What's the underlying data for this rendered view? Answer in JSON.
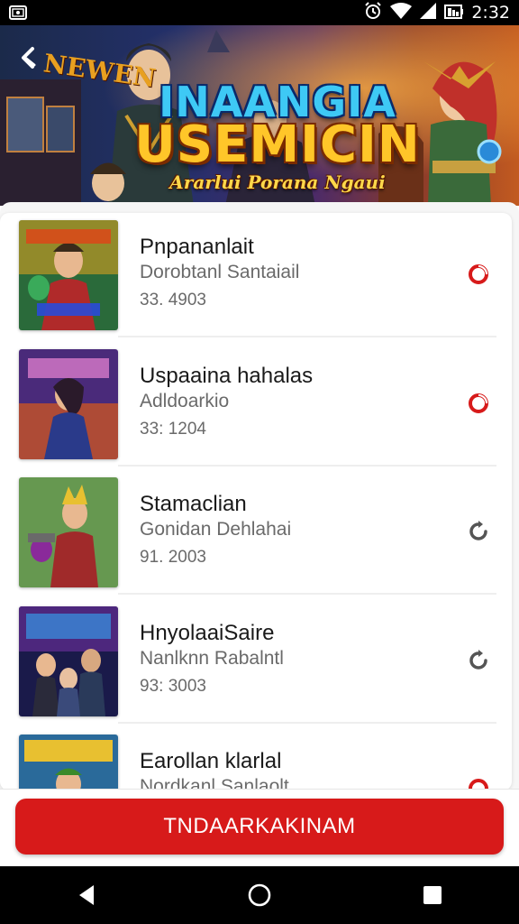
{
  "status_bar": {
    "time": "2:32",
    "app_badge": "Ⓚ",
    "icons": [
      "alarm-icon",
      "wifi-icon",
      "signal-icon",
      "battery-icon"
    ]
  },
  "hero": {
    "corner_text": "NEWEN",
    "title_line1": "INAANGIA",
    "title_line2": "USEMICIN",
    "subtitle": "Ararlui Porana Ngaui"
  },
  "items": [
    {
      "title": "Pnpananlait",
      "subtitle": "Dorobtanl Santaiail",
      "meta": "33. 4903",
      "status": "active",
      "status_icon": "record-icon"
    },
    {
      "title": "Uspaaina hahalas",
      "subtitle": "Adldoarkio",
      "meta": "33: 1204",
      "status": "active",
      "status_icon": "record-icon"
    },
    {
      "title": "Stamaclian",
      "subtitle": "Gonidan Dehlahai",
      "meta": "91. 2003",
      "status": "inactive",
      "status_icon": "refresh-icon"
    },
    {
      "title": "HnyolaaiSaire",
      "subtitle": "Nanlknn Rabalntl",
      "meta": "93: 3003",
      "status": "inactive",
      "status_icon": "refresh-icon"
    },
    {
      "title": "Earollan klarlal",
      "subtitle": "Nordkanl Sanlaolt",
      "meta": "",
      "status": "active",
      "status_icon": "record-icon"
    }
  ],
  "cta": {
    "label": "TNDAARKAKINAM"
  },
  "colors": {
    "accent_red": "#d71a1a",
    "status_active": "#d71a1a",
    "status_inactive": "#555555"
  }
}
